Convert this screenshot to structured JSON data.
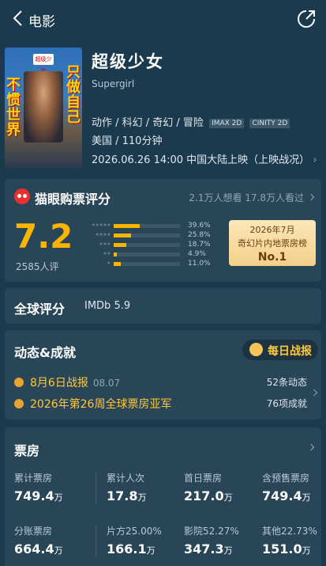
{
  "nav": {
    "title": "电影"
  },
  "movie": {
    "title": "超级少女",
    "english_title": "Supergirl",
    "genres": "动作 / 科幻 / 奇幻 / 冒险",
    "formats": [
      "IMAX 2D",
      "CINITY 2D"
    ],
    "country_duration": "美国 / 110分钟",
    "release": "2026.06.26 14:00 中国大陆上映（上映战况）",
    "poster_text_left": "不惯世界",
    "poster_text_right": "只做自己",
    "poster_badge": "超级少女"
  },
  "rating": {
    "title": "猫眼购票评分",
    "stats": "2.1万人想看 17.8万人看过",
    "score": "7.2",
    "count": "2585人评",
    "distribution": [
      {
        "stars": "★★★★★",
        "percent": "39.6%",
        "value": 0.396
      },
      {
        "stars": "★★★★",
        "percent": "25.8%",
        "value": 0.258
      },
      {
        "stars": "★★★",
        "percent": "18.7%",
        "value": 0.187
      },
      {
        "stars": "★★",
        "percent": "4.9%",
        "value": 0.049
      },
      {
        "stars": "★",
        "percent": "11.0%",
        "value": 0.11
      }
    ],
    "rank_line1": "2026年7月",
    "rank_line2": "奇幻片内地票房榜",
    "rank_line3": "No.1"
  },
  "global": {
    "title": "全球评分",
    "imdb": "IMDb 5.9"
  },
  "news": {
    "title": "动态&成就",
    "button": "每日战报",
    "items": [
      {
        "text": "8月6日战报",
        "date": "08.07"
      },
      {
        "text": "2026年第26周全球票房亚军",
        "date": ""
      }
    ],
    "count1": "52条动态",
    "count2": "76项成就"
  },
  "box_office": {
    "title": "票房",
    "cells": [
      {
        "label": "累计票房",
        "value": "749.4",
        "unit": "万"
      },
      {
        "label": "累计人次",
        "value": "17.8",
        "unit": "万"
      },
      {
        "label": "首日票房",
        "value": "217.0",
        "unit": "万"
      },
      {
        "label": "含预售票房",
        "value": "749.4",
        "unit": "万"
      },
      {
        "label": "分账票房",
        "value": "664.4",
        "unit": "万"
      },
      {
        "label": "片方25.00%",
        "value": "166.1",
        "unit": "万"
      },
      {
        "label": "影院52.27%",
        "value": "347.3",
        "unit": "万"
      },
      {
        "label": "其他22.73%",
        "value": "151.0",
        "unit": "万"
      }
    ]
  }
}
